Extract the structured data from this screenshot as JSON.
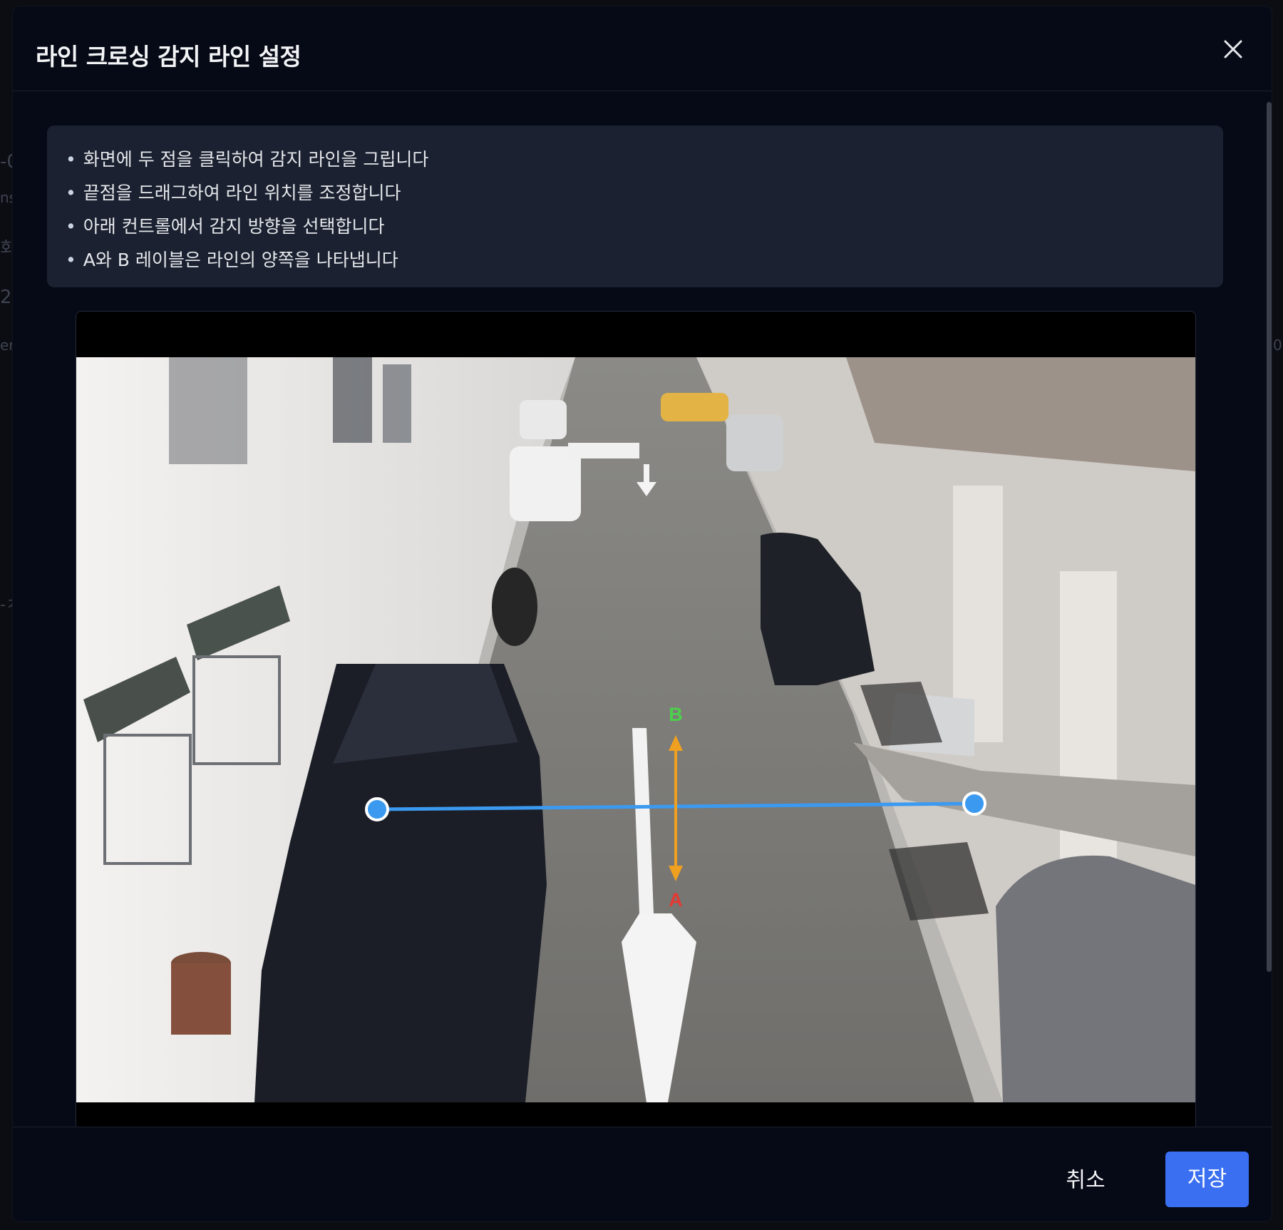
{
  "modal": {
    "title": "라인 크로싱 감지 라인 설정",
    "close_icon": "close-icon"
  },
  "instructions": [
    "화면에 두 점을 클릭하여 감지 라인을 그립니다",
    "끝점을 드래그하여 라인 위치를 조정합니다",
    "아래 컨트롤에서 감지 방향을 선택합니다",
    "A와 B 레이블은 라인의 양쪽을 나타냅니다"
  ],
  "line_overlay": {
    "label_a": "A",
    "label_b": "B",
    "line_color": "#3b9af0",
    "arrow_color": "#f0a020",
    "label_a_color": "#e53935",
    "label_b_color": "#4cd04c"
  },
  "footer": {
    "cancel_label": "취소",
    "save_label": "저장"
  },
  "colors": {
    "accent": "#3b6ff2",
    "modal_bg": "#060a16",
    "info_bg": "#1b2130"
  }
}
